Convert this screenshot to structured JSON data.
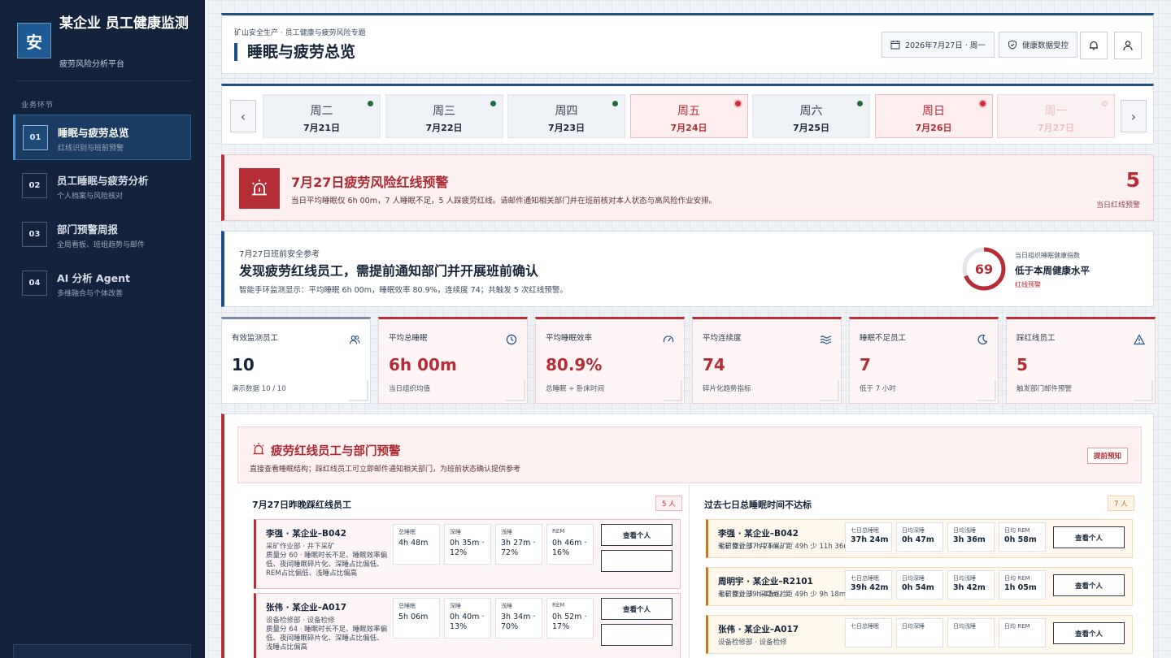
{
  "brand": {
    "logo": "安",
    "title": "某企业 员工健康监测",
    "subtitle": "疲劳风险分析平台"
  },
  "nav": {
    "section": "业务环节",
    "items": [
      {
        "num": "01",
        "label": "睡眠与疲劳总览",
        "sub": "红线识别与班前预警"
      },
      {
        "num": "02",
        "label": "员工睡眠与疲劳分析",
        "sub": "个人档案与风险核对"
      },
      {
        "num": "03",
        "label": "部门预警周报",
        "sub": "全局看板、班组趋势与邮件"
      },
      {
        "num": "04",
        "label": "AI 分析 Agent",
        "sub": "多维融合与个体改善"
      }
    ]
  },
  "header": {
    "breadcrumb": "矿山安全生产 · 员工健康与疲劳风险专题",
    "title": "睡眠与疲劳总览",
    "date": "2026年7月27日 · 周一",
    "privacy": "健康数据受控"
  },
  "days": [
    {
      "name": "周二",
      "date": "7月21日",
      "status": "ok"
    },
    {
      "name": "周三",
      "date": "7月22日",
      "status": "ok"
    },
    {
      "name": "周四",
      "date": "7月23日",
      "status": "ok"
    },
    {
      "name": "周五",
      "date": "7月24日",
      "status": "risk"
    },
    {
      "name": "周六",
      "date": "7月25日",
      "status": "ok"
    },
    {
      "name": "周日",
      "date": "7月26日",
      "status": "risk"
    },
    {
      "name": "周一",
      "date": "7月27日",
      "status": "faded"
    }
  ],
  "alert": {
    "title": "7月27日疲劳风险红线预警",
    "desc": "当日平均睡眠仅 6h 00m，7 人睡眠不足，5 人踩疲劳红线。请邮件通知相关部门并在班前核对本人状态与高风险作业安排。",
    "count": "5",
    "count_label": "当日红线预警"
  },
  "brief": {
    "tag": "7月27日班前安全参考",
    "title": "发现疲劳红线员工，需提前通知部门并开展班前确认",
    "desc": "智能手环监测显示：平均睡眠 6h 00m，睡眠效率 80.9%，连续度 74；共触发 5 次红线预警。",
    "gauge_value": "69",
    "gauge_fraction": 0.69,
    "gauge_label": "当日组织睡眠健康指数",
    "gauge_text": "低于本周健康水平",
    "gauge_status": "红线预警"
  },
  "kpis": [
    {
      "label": "有效监测员工",
      "value": "10",
      "sub": "演示数据 10 / 10",
      "tone": "neutral",
      "icon": "users-icon"
    },
    {
      "label": "平均总睡眠",
      "value": "6h 00m",
      "sub": "当日组织均值",
      "tone": "red",
      "icon": "clock-icon"
    },
    {
      "label": "平均睡眠效率",
      "value": "80.9%",
      "sub": "总睡眠 ÷ 卧床时间",
      "tone": "red",
      "icon": "gauge-icon"
    },
    {
      "label": "平均连续度",
      "value": "74",
      "sub": "碎片化趋势指标",
      "tone": "red",
      "icon": "wave-icon"
    },
    {
      "label": "睡眠不足员工",
      "value": "7",
      "sub": "低于 7 小时",
      "tone": "red",
      "icon": "moon-icon"
    },
    {
      "label": "踩红线员工",
      "value": "5",
      "sub": "触发部门邮件预警",
      "tone": "red",
      "icon": "warning-icon"
    }
  ],
  "section": {
    "title": "疲劳红线员工与部门预警",
    "desc": "直接查看睡眠结构；踩红线员工可立即邮件通知相关部门，为班前状态确认提供参考",
    "tag": "提前预知",
    "left": {
      "title": "7月27日昨晚踩红线员工",
      "count": "5 人",
      "cards": [
        {
          "name": "李强 · 某企业–B042",
          "dept": "采矿作业部 · 井下采矿",
          "note": "质量分 60 · 睡眠时长不足、睡眠效率偏低、夜间睡眠碎片化、深睡占比偏低、REM占比偏低、浅睡占比偏高",
          "metrics": [
            {
              "label": "总睡眠",
              "value": "4h 48m"
            },
            {
              "label": "深睡",
              "value": "0h 35m · 12%"
            },
            {
              "label": "浅睡",
              "value": "3h 27m · 72%"
            },
            {
              "label": "REM",
              "value": "0h 46m · 16%"
            }
          ],
          "button": "查看个人"
        },
        {
          "name": "张伟 · 某企业–A017",
          "dept": "设备检修部 · 设备检修",
          "note": "质量分 64 · 睡眠时长不足、睡眠效率偏低、夜间睡眠碎片化、深睡占比偏低、浅睡占比偏高",
          "metrics": [
            {
              "label": "总睡眠",
              "value": "5h 06m"
            },
            {
              "label": "深睡",
              "value": "0h 40m · 13%"
            },
            {
              "label": "浅睡",
              "value": "3h 34m · 70%"
            },
            {
              "label": "REM",
              "value": "0h 52m · 17%"
            }
          ],
          "button": "查看个人"
        }
      ]
    },
    "right": {
      "title": "过去七日总睡眠时间不达标",
      "count": "7 人",
      "cards": [
        {
          "name": "李强 · 某企业–B042",
          "dept": "采矿作业部 · 井下采矿",
          "note": "七日累计 37h 24m，距 49h 少 11h 36m",
          "metrics": [
            {
              "label": "七日总睡眠",
              "value": "37h 24m"
            },
            {
              "label": "日均深睡",
              "value": "0h 47m"
            },
            {
              "label": "日均浅睡",
              "value": "3h 36m"
            },
            {
              "label": "日均 REM",
              "value": "0h 58m"
            }
          ],
          "button": "查看个人"
        },
        {
          "name": "周明宇 · 某企业–R2101",
          "dept": "采矿作业部 · 采场巡检",
          "note": "七日累计 39h 42m，距 49h 少 9h 18m",
          "metrics": [
            {
              "label": "七日总睡眠",
              "value": "39h 42m"
            },
            {
              "label": "日均深睡",
              "value": "0h 54m"
            },
            {
              "label": "日均浅睡",
              "value": "3h 42m"
            },
            {
              "label": "日均 REM",
              "value": "1h 05m"
            }
          ],
          "button": "查看个人"
        },
        {
          "name": "张伟 · 某企业–A017",
          "dept": "设备检修部 · 设备检修",
          "note": "",
          "metrics": [
            {
              "label": "七日总睡眠",
              "value": ""
            },
            {
              "label": "日均深睡",
              "value": ""
            },
            {
              "label": "日均浅睡",
              "value": ""
            },
            {
              "label": "日均 REM",
              "value": ""
            }
          ],
          "button": "查看个人"
        }
      ]
    }
  },
  "colors": {
    "primary": "#1d4f86",
    "danger": "#b52e37",
    "warning": "#c77a1d",
    "sidebar": "#13233b"
  }
}
